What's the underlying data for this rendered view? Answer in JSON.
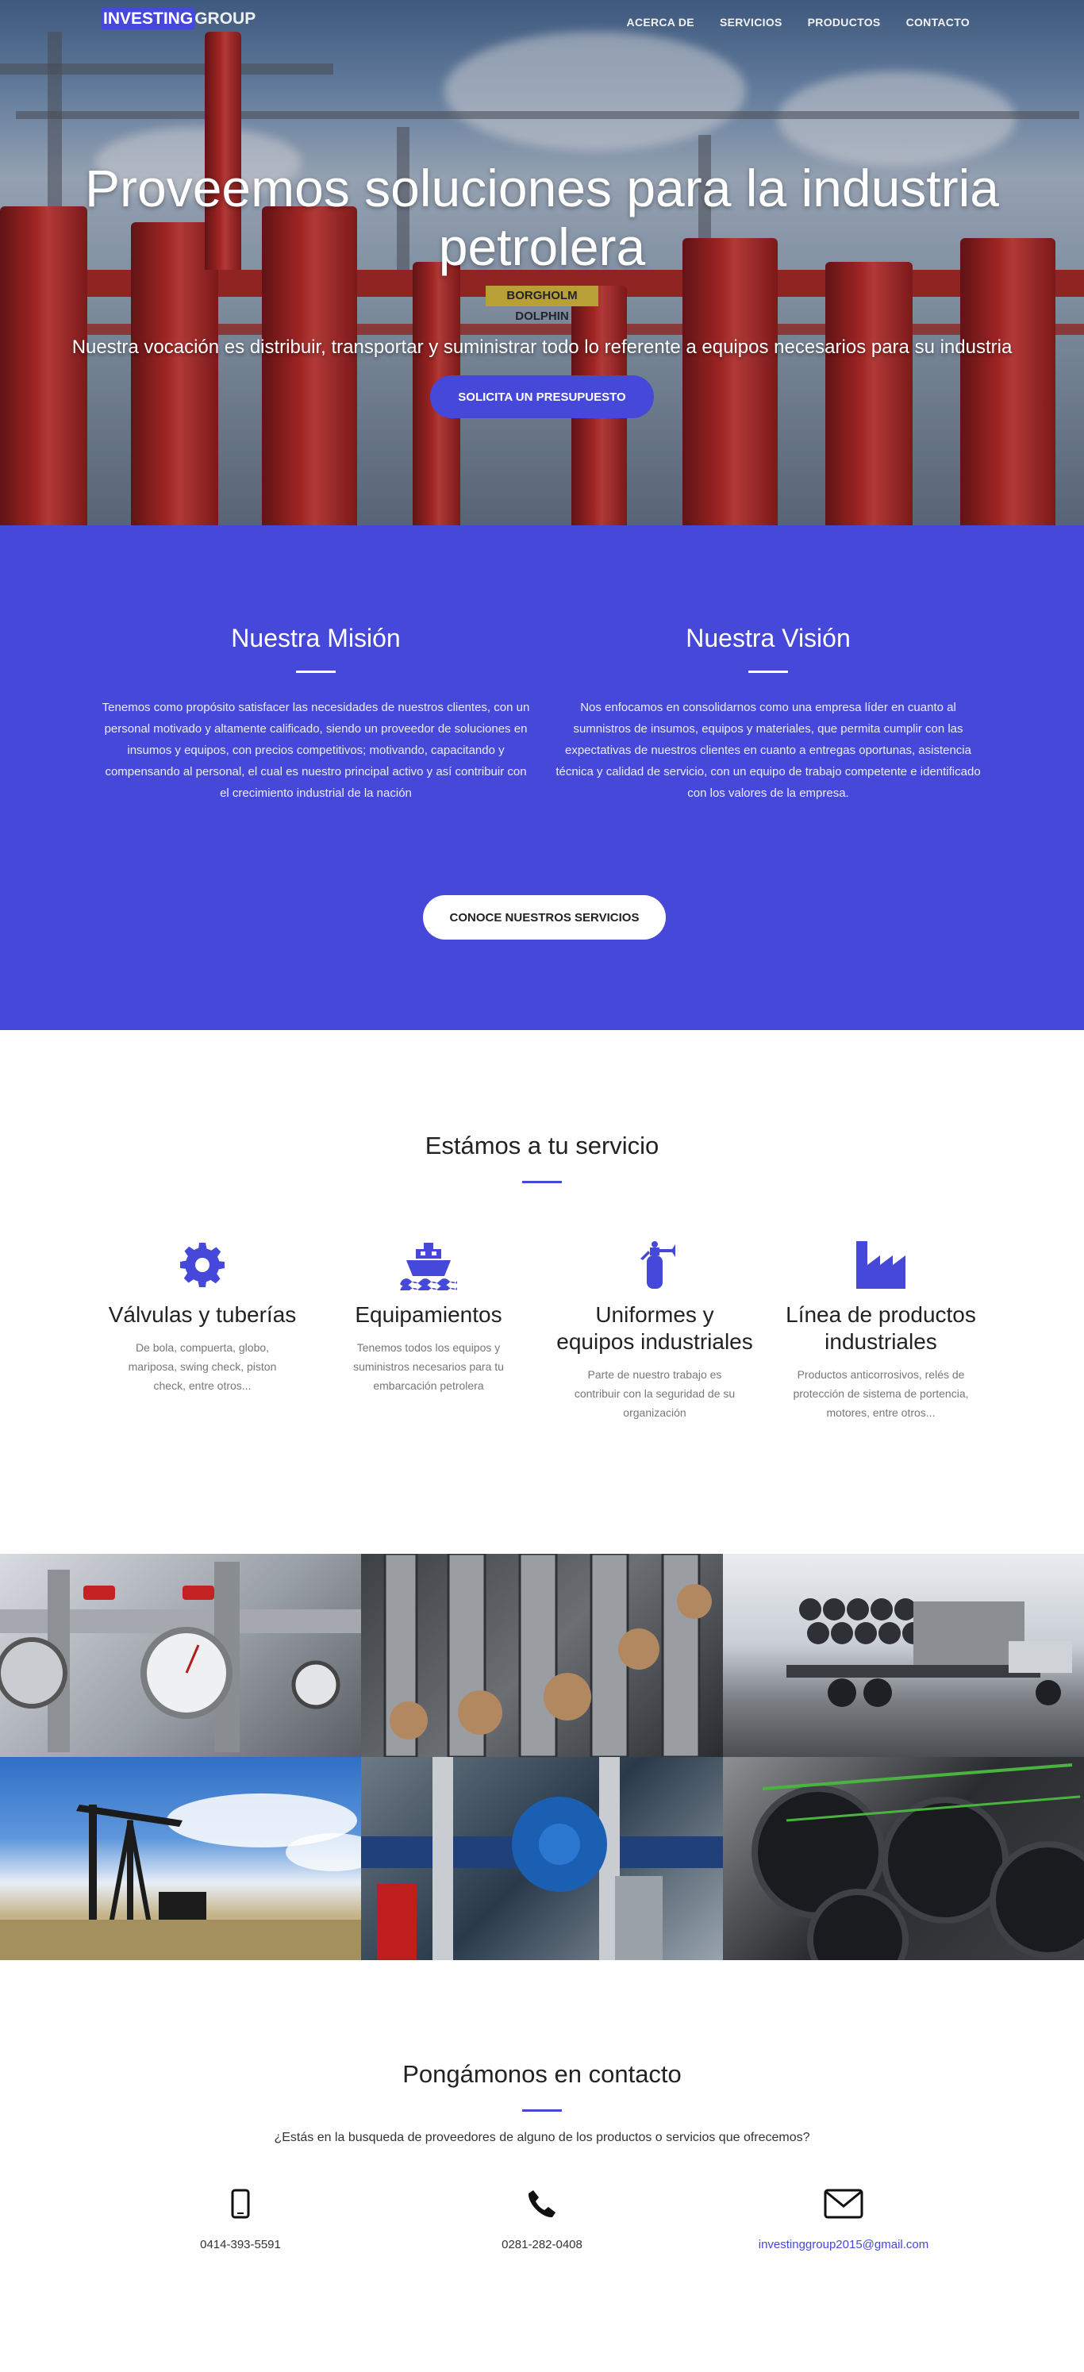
{
  "nav": {
    "brand_part1": "INVESTING",
    "brand_part2": "GROUP",
    "links": [
      "ACERCA DE",
      "SERVICIOS",
      "PRODUCTOS",
      "CONTACTO"
    ]
  },
  "hero": {
    "title": "Proveemos soluciones para la industria petrolera",
    "subtitle": "Nuestra vocación es distribuir, transportar y suministrar todo lo referente a equipos necesarios para su industria",
    "cta": "SOLICITA UN PRESUPUESTO",
    "rig_sign": "BORGHOLM DOLPHIN"
  },
  "mission": {
    "title": "Nuestra Misión",
    "text": "Tenemos como propósito satisfacer las necesidades de nuestros clientes, con un personal motivado y altamente calificado, siendo un proveedor de soluciones en insumos y equipos, con precios competitivos; motivando, capacitando y compensando al personal, el cual es nuestro principal activo y así contribuir con el crecimiento industrial de la nación"
  },
  "vision": {
    "title": "Nuestra Visión",
    "text": "Nos enfocamos en consolidarnos como una empresa líder en cuanto al sumnistros de insumos, equipos y materiales, que permita cumplir con las expectativas de nuestros clientes en cuanto a entregas oportunas, asistencia técnica y calidad de servicio, con un equipo de trabajo competente e identificado con los valores de la empresa."
  },
  "mission_cta": "CONOCE NUESTROS SERVICIOS",
  "services": {
    "title": "Estámos a tu servicio",
    "items": [
      {
        "icon": "gear-icon",
        "title": "Válvulas y tuberías",
        "text": "De bola, compuerta, globo, mariposa, swing check, piston check, entre otros..."
      },
      {
        "icon": "ship-icon",
        "title": "Equipamientos",
        "text": "Tenemos todos los equipos y suministros necesarios para tu embarcación petrolera"
      },
      {
        "icon": "fire-extinguisher-icon",
        "title": "Uniformes y equipos industriales",
        "text": "Parte de nuestro trabajo es contribuir con la seguridad de su organización"
      },
      {
        "icon": "industry-icon",
        "title": "Línea de productos industriales",
        "text": "Productos anticorrosivos, relés de protección de sistema de portencia, motores, entre otros..."
      }
    ]
  },
  "contact": {
    "title": "Pongámonos en contacto",
    "question": "¿Estás en la busqueda de proveedores de alguno de los productos o servicios que ofrecemos?",
    "mobile": "0414-393-5591",
    "phone": "0281-282-0408",
    "email": "investinggroup2015@gmail.com"
  },
  "colors": {
    "accent": "#4648d9",
    "text": "#222222",
    "muted": "#777777"
  }
}
